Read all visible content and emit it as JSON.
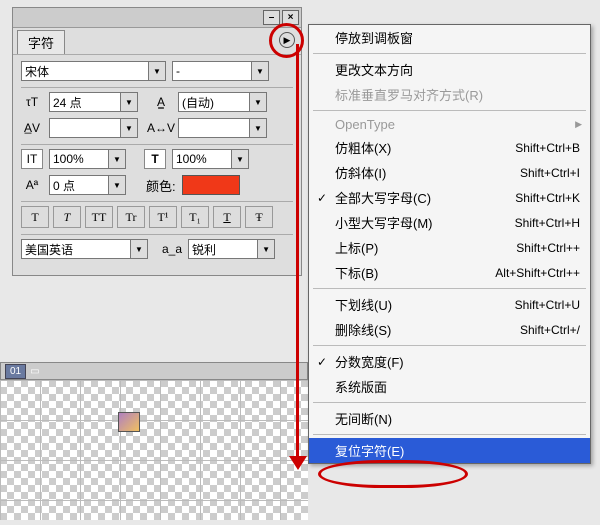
{
  "panel": {
    "tab_label": "字符",
    "font_family": "宋体",
    "font_style": "-",
    "size_value": "24 点",
    "leading_value": "(自动)",
    "kerning_value": "",
    "tracking_value": "",
    "hscale_value": "100%",
    "vscale_value": "100%",
    "baseline_value": "0 点",
    "color_label": "颜色:",
    "color_hex": "#f03818",
    "language": "美国英语",
    "aa_prefix": "a_a",
    "antialias": "锐利",
    "buttons": [
      "T",
      "T",
      "TT",
      "Tr",
      "T¹",
      "T₁",
      "T",
      "Ŧ"
    ]
  },
  "menu": {
    "items": [
      {
        "label": "停放到调板窗"
      },
      {
        "sep": true
      },
      {
        "label": "更改文本方向"
      },
      {
        "label": "标准垂直罗马对齐方式(R)",
        "disabled": true
      },
      {
        "sep": true
      },
      {
        "label": "OpenType",
        "disabled": true,
        "sub": true
      },
      {
        "label": "仿粗体(X)",
        "shortcut": "Shift+Ctrl+B"
      },
      {
        "label": "仿斜体(I)",
        "shortcut": "Shift+Ctrl+I"
      },
      {
        "label": "全部大写字母(C)",
        "check": true,
        "shortcut": "Shift+Ctrl+K"
      },
      {
        "label": "小型大写字母(M)",
        "shortcut": "Shift+Ctrl+H"
      },
      {
        "label": "上标(P)",
        "shortcut": "Shift+Ctrl++"
      },
      {
        "label": "下标(B)",
        "shortcut": "Alt+Shift+Ctrl++"
      },
      {
        "sep": true
      },
      {
        "label": "下划线(U)",
        "shortcut": "Shift+Ctrl+U"
      },
      {
        "label": "删除线(S)",
        "shortcut": "Shift+Ctrl+/"
      },
      {
        "sep": true
      },
      {
        "label": "分数宽度(F)",
        "check": true
      },
      {
        "label": "系统版面"
      },
      {
        "sep": true
      },
      {
        "label": "无间断(N)"
      },
      {
        "sep": true
      },
      {
        "label": "复位字符(E)",
        "highlight": true
      }
    ]
  },
  "strip": {
    "frame": "01"
  }
}
